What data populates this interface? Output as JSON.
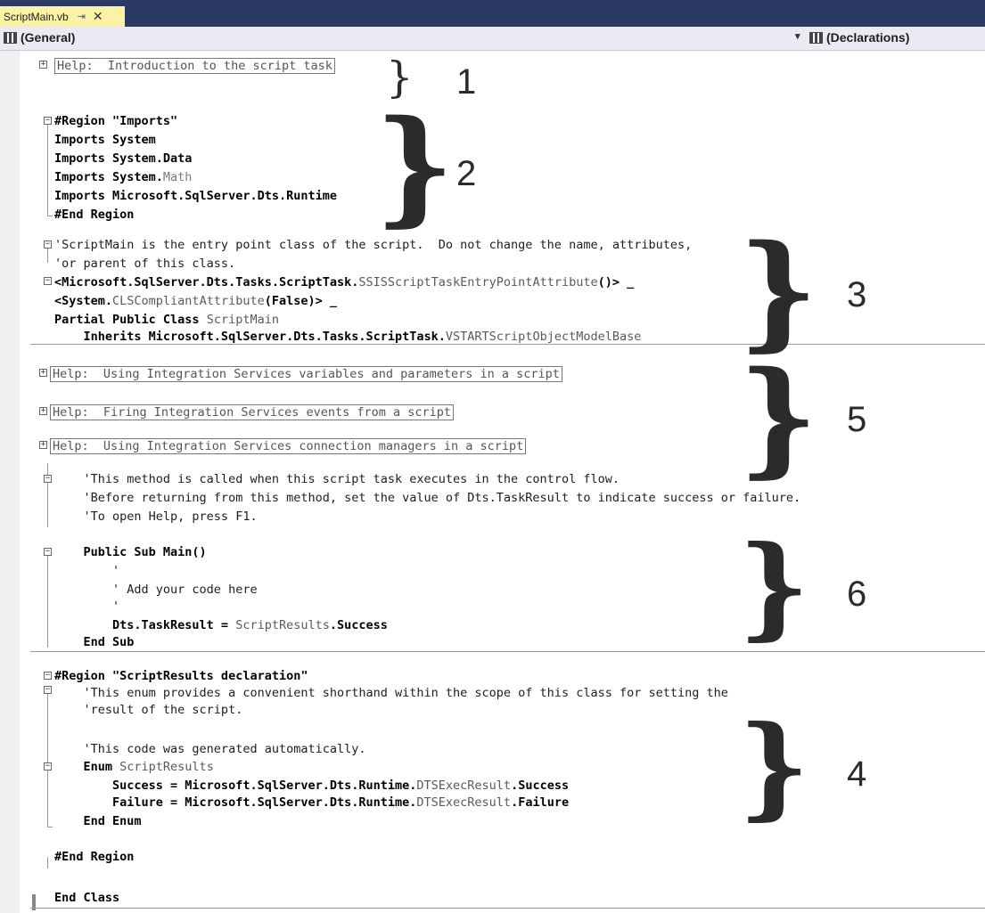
{
  "tab": {
    "filename": "ScriptMain.vb",
    "pin": "⇥",
    "close": "✕"
  },
  "navbar": {
    "left": "(General)",
    "right": "(Declarations)",
    "dropdown": "▾"
  },
  "code": {
    "l1": "Help:  Introduction to the script task",
    "l2": "#Region \"Imports\"",
    "l3": "Imports System",
    "l4": "Imports System.Data",
    "l5a": "Imports System.",
    "l5b": "Math",
    "l6": "Imports Microsoft.SqlServer.Dts.Runtime",
    "l7": "#End Region",
    "l8": "'ScriptMain is the entry point class of the script.  Do not change the name, attributes,",
    "l9": "'or parent of this class.",
    "l10a": "<Microsoft.SqlServer.Dts.Tasks.ScriptTask.",
    "l10b": "SSISScriptTaskEntryPointAttribute",
    "l10c": "()> _",
    "l11a": "<System.",
    "l11b": "CLSCompliantAttribute",
    "l11c": "(False)> _",
    "l12a": "Partial Public Class ",
    "l12b": "ScriptMain",
    "l13a": "    Inherits Microsoft.SqlServer.Dts.Tasks.ScriptTask.",
    "l13b": "VSTARTScriptObjectModelBase",
    "l14": "Help:  Using Integration Services variables and parameters in a script",
    "l15": "Help:  Firing Integration Services events from a script",
    "l16": "Help:  Using Integration Services connection managers in a script",
    "l17": "    'This method is called when this script task executes in the control flow.",
    "l18": "    'Before returning from this method, set the value of Dts.TaskResult to indicate success or failure.",
    "l19": "    'To open Help, press F1.",
    "l20": "    Public Sub Main()",
    "l21": "        '",
    "l22": "        ' Add your code here",
    "l23": "        '",
    "l24a": "        Dts.TaskResult = ",
    "l24b": "ScriptResults",
    "l24c": ".Success",
    "l25": "    End Sub",
    "l26": "#Region \"ScriptResults declaration\"",
    "l27": "    'This enum provides a convenient shorthand within the scope of this class for setting the",
    "l28": "    'result of the script.",
    "l29": "    'This code was generated automatically.",
    "l30a": "    Enum ",
    "l30b": "ScriptResults",
    "l31a": "        Success = Microsoft.SqlServer.Dts.Runtime.",
    "l31b": "DTSExecResult",
    "l31c": ".Success",
    "l32a": "        Failure = Microsoft.SqlServer.Dts.Runtime.",
    "l32b": "DTSExecResult",
    "l32c": ".Failure",
    "l33": "    End Enum",
    "l34": "#End Region",
    "l35": "End Class"
  },
  "annotations": {
    "a1": "1",
    "a2": "2",
    "a3": "3",
    "a5": "5",
    "a6": "6",
    "a4": "4"
  }
}
